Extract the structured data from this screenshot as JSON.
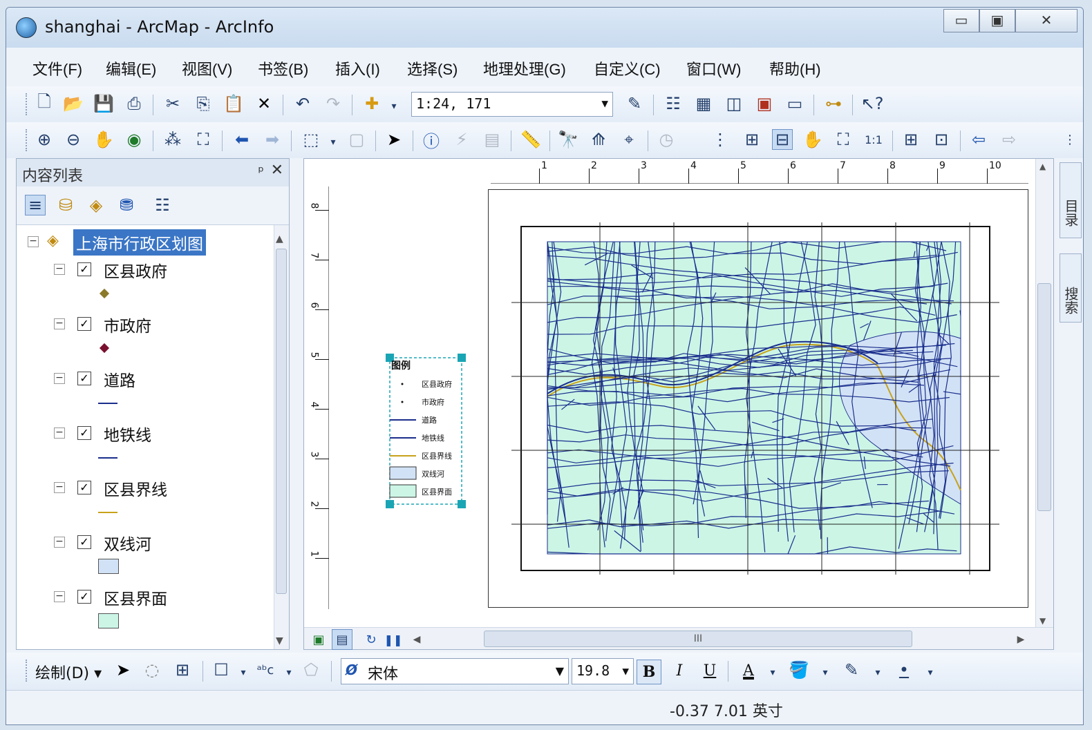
{
  "window": {
    "title": "shanghai - ArcMap - ArcInfo",
    "minimize": "▭",
    "maximize": "▣",
    "close": "✕"
  },
  "menu": [
    "文件(F)",
    "编辑(E)",
    "视图(V)",
    "书签(B)",
    "插入(I)",
    "选择(S)",
    "地理处理(G)",
    "自定义(C)",
    "窗口(W)",
    "帮助(H)"
  ],
  "standard_toolbar": {
    "scale": "1:24, 171"
  },
  "toc": {
    "title": "内容列表",
    "pin": "ᵖ",
    "close": "✕",
    "group": "上海市行政区划图",
    "layers": [
      {
        "name": "区县政府",
        "checked": "☑",
        "symbol": "point",
        "color": "#8a7a2a"
      },
      {
        "name": "市政府",
        "checked": "☑",
        "symbol": "point",
        "color": "#7a1030"
      },
      {
        "name": "道路",
        "checked": "☑",
        "symbol": "line",
        "color": "#1a2e8c"
      },
      {
        "name": "地铁线",
        "checked": "☑",
        "symbol": "line",
        "color": "#1a2e8c"
      },
      {
        "name": "区县界线",
        "checked": "☑",
        "symbol": "line",
        "color": "#c7a21a"
      },
      {
        "name": "双线河",
        "checked": "☑",
        "symbol": "fill",
        "color": "#d2e2f6"
      },
      {
        "name": "区县界面",
        "checked": "☑",
        "symbol": "fill",
        "color": "#ccf5e6"
      }
    ]
  },
  "layout": {
    "ruler_h_ticks": [
      "1",
      "2",
      "3",
      "4",
      "5",
      "6",
      "7",
      "8",
      "9",
      "10"
    ],
    "ruler_v_ticks": [
      "8",
      "7",
      "6",
      "5",
      "4",
      "3",
      "2",
      "1"
    ],
    "legend": {
      "title": "图例",
      "items": [
        "区县政府",
        "市政府",
        "道路",
        "地铁线",
        "区县界线",
        "双线河",
        "区县界面"
      ]
    },
    "scroll_h_mark": "III"
  },
  "side_tabs": [
    "目录",
    "搜索"
  ],
  "draw_toolbar": {
    "draw_label": "绘制(D) ▾",
    "font": "宋体",
    "size": "19.8",
    "bold": "B",
    "italic": "I",
    "underline": "U",
    "font_color": "A"
  },
  "status": {
    "coords": "-0.37  7.01 英寸"
  },
  "colors": {
    "map_fill": "#ccf5e6",
    "river": "#d2e2f6",
    "road": "#1a2e8c",
    "boundary": "#c7a21a",
    "selection": "#3b76c6"
  }
}
